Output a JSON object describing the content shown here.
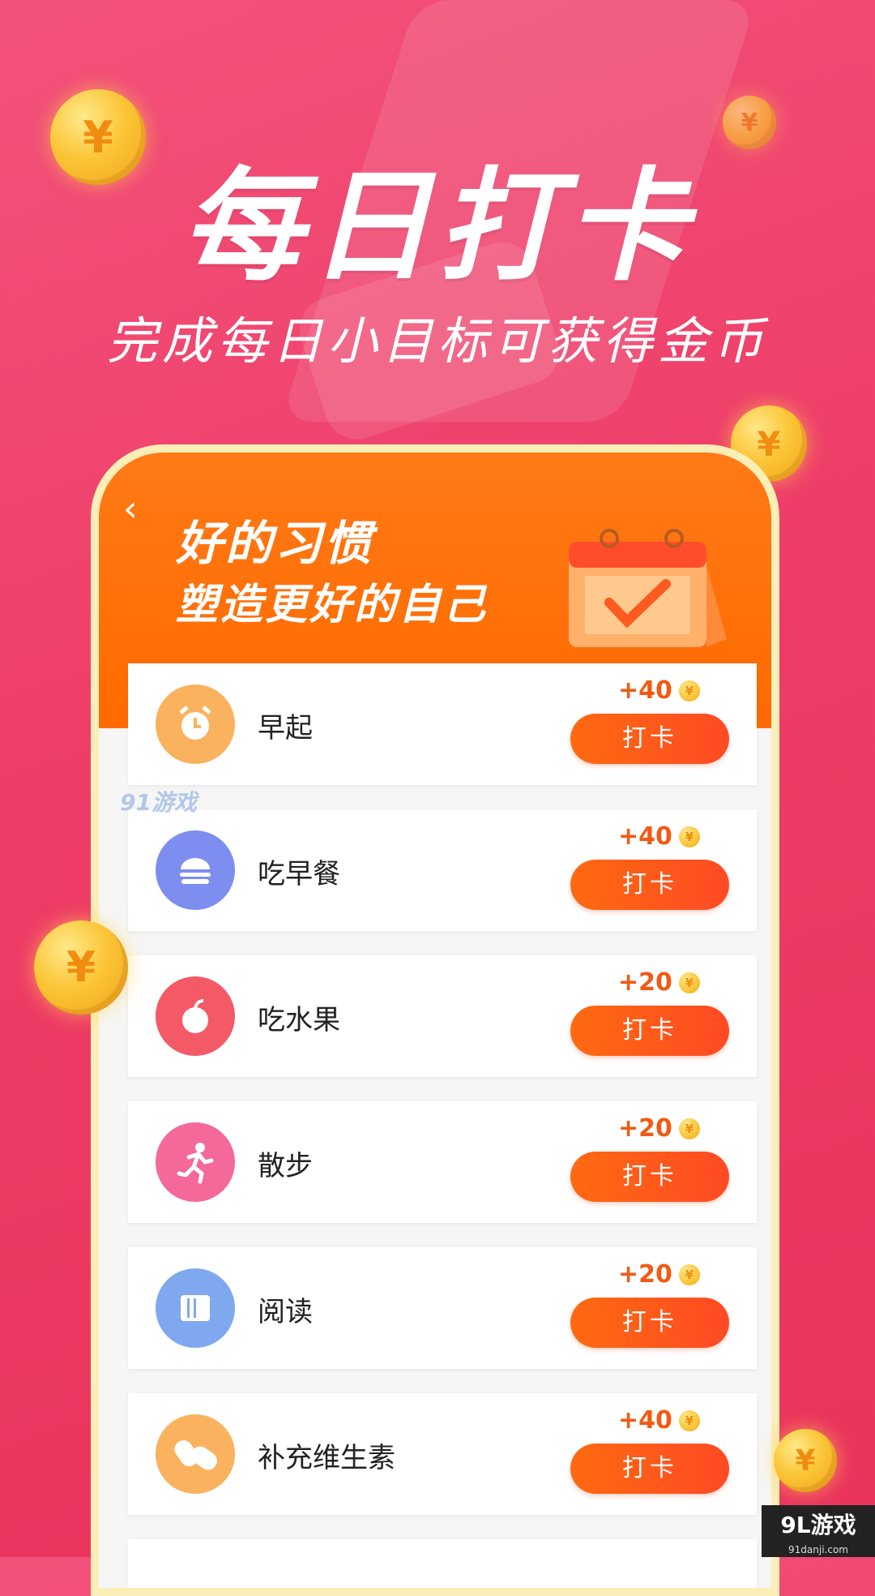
{
  "hero": {
    "title": "每日打卡",
    "subtitle": "完成每日小目标可获得金币"
  },
  "banner": {
    "back_glyph": "‹",
    "title": "好的习惯",
    "subtitle": "塑造更好的自己"
  },
  "coin_glyph": "¥",
  "checkin_label": "打卡",
  "tasks": [
    {
      "label": "早起",
      "reward": "+40",
      "icon": "alarm-clock-icon",
      "color": "#fbb25e"
    },
    {
      "label": "吃早餐",
      "reward": "+40",
      "icon": "burger-icon",
      "color": "#7d8df0"
    },
    {
      "label": "吃水果",
      "reward": "+20",
      "icon": "apple-icon",
      "color": "#f35a66"
    },
    {
      "label": "散步",
      "reward": "+20",
      "icon": "running-person-icon",
      "color": "#f4689a"
    },
    {
      "label": "阅读",
      "reward": "+20",
      "icon": "book-icon",
      "color": "#7fa8ef"
    },
    {
      "label": "补充维生素",
      "reward": "+40",
      "icon": "pill-icon",
      "color": "#fbb25e"
    }
  ],
  "watermark": "91游戏",
  "badge": {
    "title": "9L游戏",
    "url": "91danji.com"
  }
}
